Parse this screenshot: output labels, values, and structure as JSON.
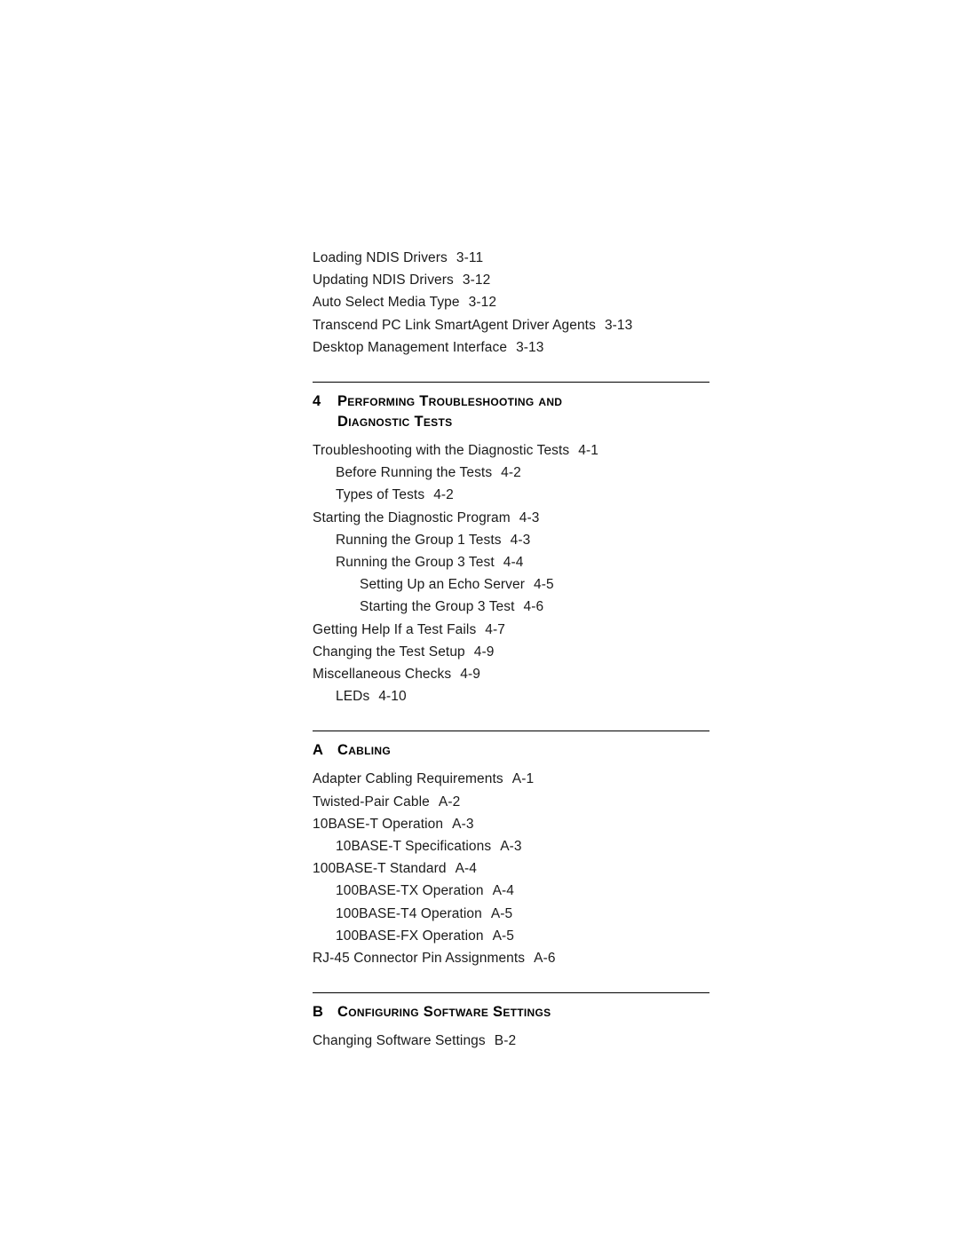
{
  "document": {
    "type": "table-of-contents",
    "top_entries": [
      {
        "label": "Loading NDIS Drivers",
        "page": "3-11",
        "level": 0
      },
      {
        "label": "Updating NDIS Drivers",
        "page": "3-12",
        "level": 0
      },
      {
        "label": "Auto Select Media Type",
        "page": "3-12",
        "level": 0
      },
      {
        "label": "Transcend PC Link SmartAgent Driver Agents",
        "page": "3-13",
        "level": 0
      },
      {
        "label": "Desktop Management Interface",
        "page": "3-13",
        "level": 0
      }
    ],
    "chapters": [
      {
        "number": "4",
        "title_line1": "Performing Troubleshooting and",
        "title_line2": "Diagnostic Tests",
        "entries": [
          {
            "label": "Troubleshooting with the Diagnostic Tests",
            "page": "4-1",
            "level": 0
          },
          {
            "label": "Before Running the Tests",
            "page": "4-2",
            "level": 1
          },
          {
            "label": "Types of Tests",
            "page": "4-2",
            "level": 1
          },
          {
            "label": "Starting the Diagnostic Program",
            "page": "4-3",
            "level": 0
          },
          {
            "label": "Running the Group 1 Tests",
            "page": "4-3",
            "level": 1
          },
          {
            "label": "Running the Group 3 Test",
            "page": "4-4",
            "level": 1
          },
          {
            "label": "Setting Up an Echo Server",
            "page": "4-5",
            "level": 2
          },
          {
            "label": "Starting the Group 3 Test",
            "page": "4-6",
            "level": 2
          },
          {
            "label": "Getting Help If a Test Fails",
            "page": "4-7",
            "level": 0
          },
          {
            "label": "Changing the Test Setup",
            "page": "4-9",
            "level": 0
          },
          {
            "label": "Miscellaneous Checks",
            "page": "4-9",
            "level": 0
          },
          {
            "label": "LEDs",
            "page": "4-10",
            "level": 1
          }
        ]
      },
      {
        "number": "A",
        "title_line1": "Cabling",
        "title_line2": "",
        "entries": [
          {
            "label": "Adapter Cabling Requirements",
            "page": "A-1",
            "level": 0
          },
          {
            "label": "Twisted-Pair Cable",
            "page": "A-2",
            "level": 0
          },
          {
            "label": "10BASE-T Operation",
            "page": "A-3",
            "level": 0
          },
          {
            "label": "10BASE-T Specifications",
            "page": "A-3",
            "level": 1
          },
          {
            "label": "100BASE-T Standard",
            "page": "A-4",
            "level": 0
          },
          {
            "label": "100BASE-TX Operation",
            "page": "A-4",
            "level": 1
          },
          {
            "label": "100BASE-T4 Operation",
            "page": "A-5",
            "level": 1
          },
          {
            "label": "100BASE-FX Operation",
            "page": "A-5",
            "level": 1
          },
          {
            "label": "RJ-45 Connector Pin Assignments",
            "page": "A-6",
            "level": 0
          }
        ]
      },
      {
        "number": "B",
        "title_line1": "Configuring Software Settings",
        "title_line2": "",
        "entries": [
          {
            "label": "Changing Software Settings",
            "page": "B-2",
            "level": 0
          }
        ]
      }
    ]
  }
}
